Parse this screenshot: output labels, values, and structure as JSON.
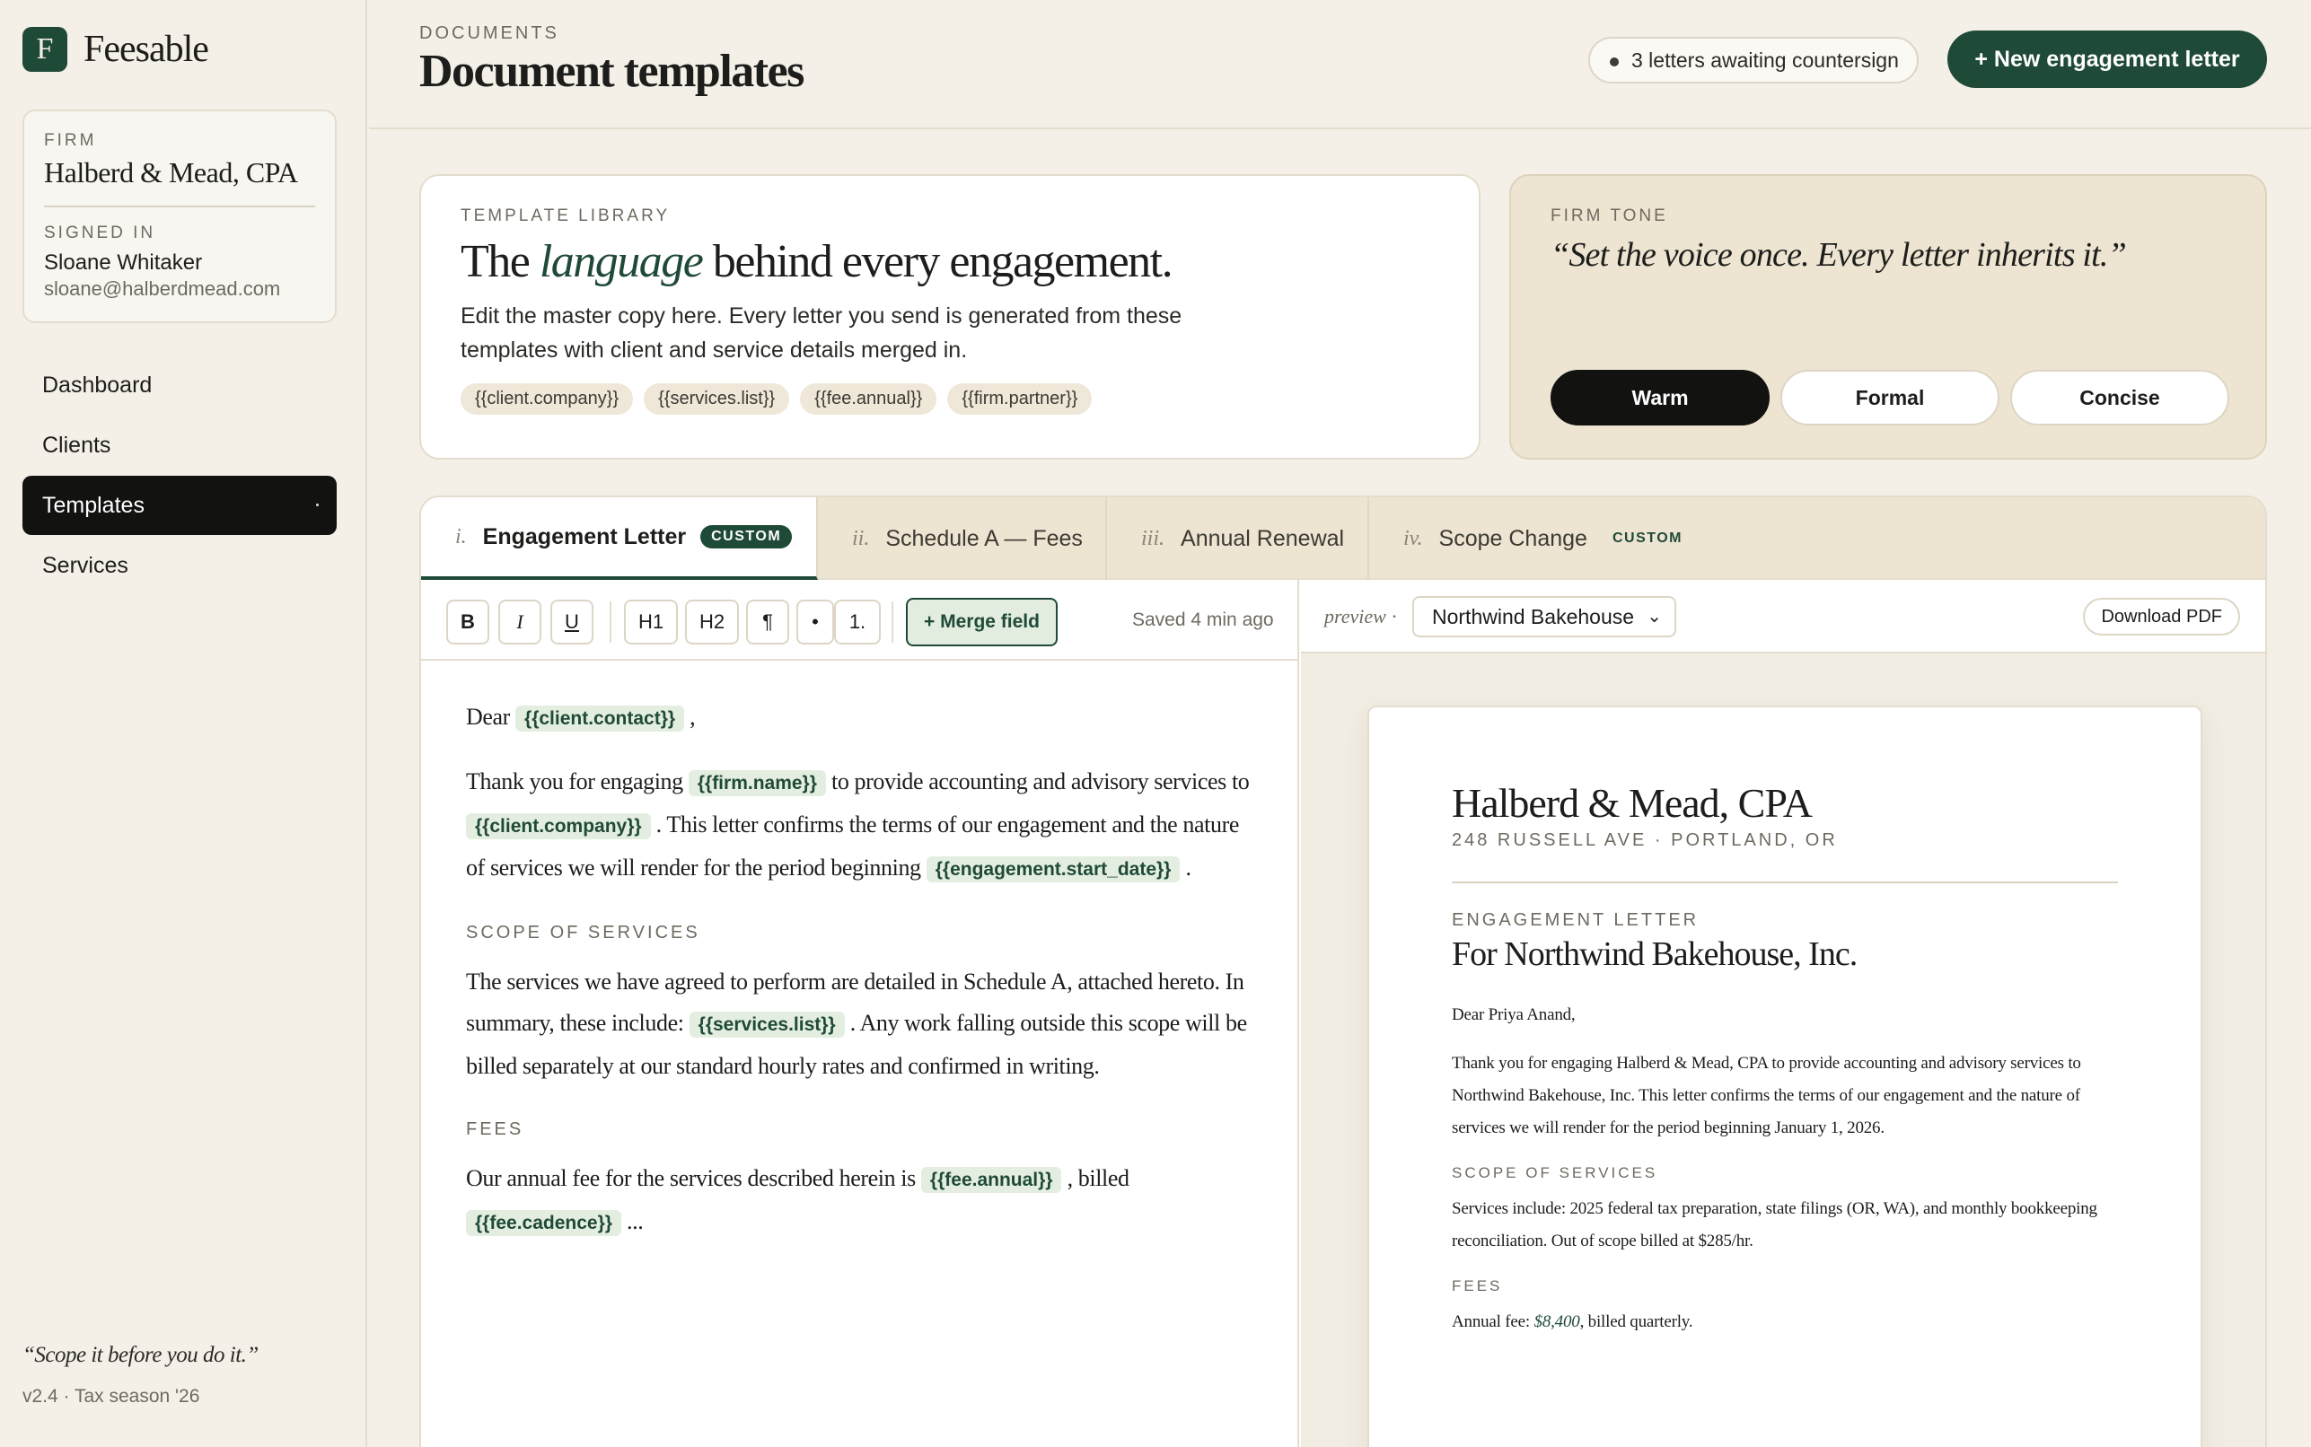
{
  "brand": {
    "mark": "F",
    "name": "Feesable"
  },
  "firm_card": {
    "firm_label": "FIRM",
    "firm_name": "Halberd & Mead, CPA",
    "signed_in_label": "SIGNED IN",
    "user_name": "Sloane Whitaker",
    "user_email": "sloane@halberdmead.com"
  },
  "nav": {
    "items": [
      {
        "label": "Dashboard"
      },
      {
        "label": "Clients"
      },
      {
        "label": "Templates",
        "active": true
      },
      {
        "label": "Services"
      }
    ]
  },
  "sidebar_footer": {
    "quote": "“Scope it before you do it.”",
    "version": "v2.4 · Tax season '26"
  },
  "header": {
    "crumb": "DOCUMENTS",
    "title": "Document templates",
    "awaiting": "3 letters awaiting countersign",
    "new_button": "+ New engagement letter"
  },
  "library": {
    "label": "TEMPLATE LIBRARY",
    "title_pre": "The ",
    "title_em": "language",
    "title_post": " behind every engagement.",
    "description": "Edit the master copy here. Every letter you send is generated from these templates with client and service details merged in.",
    "chips": [
      "{{client.company}}",
      "{{services.list}}",
      "{{fee.annual}}",
      "{{firm.partner}}"
    ]
  },
  "tone": {
    "label": "FIRM TONE",
    "quote": "“Set the voice once. Every letter inherits it.”",
    "options": [
      "Warm",
      "Formal",
      "Concise"
    ],
    "selected": "Warm"
  },
  "tabs": [
    {
      "num": "i.",
      "label": "Engagement Letter",
      "badge": "CUSTOM",
      "active": true
    },
    {
      "num": "ii.",
      "label": "Schedule A — Fees",
      "badge": ""
    },
    {
      "num": "iii.",
      "label": "Annual Renewal",
      "badge": ""
    },
    {
      "num": "iv.",
      "label": "Scope Change",
      "badge": "CUSTOM"
    }
  ],
  "toolbar": {
    "bold": "B",
    "italic": "I",
    "underline": "U",
    "h1": "H1",
    "h2": "H2",
    "para": "¶",
    "bullet": "•",
    "numbered": "1.",
    "merge": "+ Merge field",
    "saved": "Saved 4 min ago"
  },
  "editor": {
    "p1_pre": "Dear ",
    "p1_field": "{{client.contact}}",
    "p1_post": " ,",
    "p2_a": "Thank you for engaging ",
    "p2_f1": "{{firm.name}}",
    "p2_b": " to provide accounting and advisory services to ",
    "p2_f2": "{{client.company}}",
    "p2_c": " . This letter confirms the terms of our engagement and the nature of services we will render for the period beginning ",
    "p2_f3": "{{engagement.start_date}}",
    "p2_d": " .",
    "scope_heading": "SCOPE OF SERVICES",
    "p3_a": "The services we have agreed to perform are detailed in Schedule A, attached hereto. In summary, these include: ",
    "p3_f1": "{{services.list}}",
    "p3_b": " . Any work falling outside this scope will be billed separately at our standard hourly rates and confirmed in writing.",
    "fees_heading": "FEES",
    "p4_a": "Our annual fee for the services described herein is ",
    "p4_f1": "{{fee.annual}}",
    "p4_b": " , billed ",
    "p4_f2": "{{fee.cadence}}",
    "p4_c": " ..."
  },
  "preview": {
    "label": "preview",
    "sep": "·",
    "client": "Northwind Bakehouse",
    "download": "Download PDF",
    "firm": "Halberd & Mead, CPA",
    "address": "248 RUSSELL AVE · PORTLAND, OR",
    "kicker": "ENGAGEMENT LETTER",
    "title": "For Northwind Bakehouse, Inc.",
    "salutation": "Dear Priya Anand,",
    "body1": "Thank you for engaging Halberd & Mead, CPA to provide accounting and advisory services to Northwind Bakehouse, Inc. This letter confirms the terms of our engagement and the nature of services we will render for the period beginning January 1, 2026.",
    "scope_heading": "SCOPE OF SERVICES",
    "scope_body": "Services include: 2025 federal tax preparation, state filings (OR, WA), and monthly bookkeeping reconciliation. Out of scope billed at $285/hr.",
    "fees_heading": "FEES",
    "fees_pre": "Annual fee: ",
    "fees_amount": "$8,400",
    "fees_post": ", billed quarterly."
  },
  "colors": {
    "accent": "#1f4a38",
    "background": "#f4f0e7",
    "dark": "#121211"
  }
}
